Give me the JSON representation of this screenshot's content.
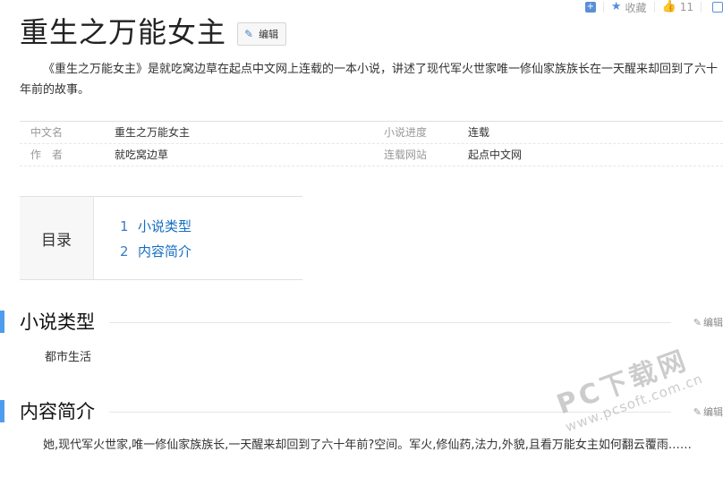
{
  "toolbar": {
    "add_icon": "plus-square-icon",
    "favorite_icon": "star-icon",
    "favorite_label": "收藏",
    "like_icon": "thumbs-up-icon",
    "like_count": "11",
    "share_icon": "share-icon"
  },
  "title": "重生之万能女主",
  "edit_label": "编辑",
  "summary": "《重生之万能女主》是就吃窝边草在起点中文网上连载的一本小说，讲述了现代军火世家唯一修仙家族族长在一天醒来却回到了六十年前的故事。",
  "basic_info": {
    "rows": [
      {
        "k1": "中文名",
        "v1": "重生之万能女主",
        "k2": "小说进度",
        "v2": "连载"
      },
      {
        "k1": "作　者",
        "v1": "就吃窝边草",
        "k2": "连载网站",
        "v2": "起点中文网"
      }
    ]
  },
  "catalog": {
    "head": "目录",
    "items": [
      {
        "num": "1",
        "label": "小说类型"
      },
      {
        "num": "2",
        "label": "内容简介"
      }
    ]
  },
  "sections": [
    {
      "title": "小说类型",
      "edit": "编辑",
      "content": "都市生活"
    },
    {
      "title": "内容简介",
      "edit": "编辑",
      "content": "她,现代军火世家,唯一修仙家族族长,一天醒来却回到了六十年前?空间。军火,修仙药,法力,外貌,且看万能女主如何翻云覆雨……"
    }
  ],
  "watermark": {
    "main": "PC下载网",
    "sub": "www.pcsoft.com.cn"
  },
  "colors": {
    "accent": "#4f9cee",
    "link": "#136ec2"
  }
}
